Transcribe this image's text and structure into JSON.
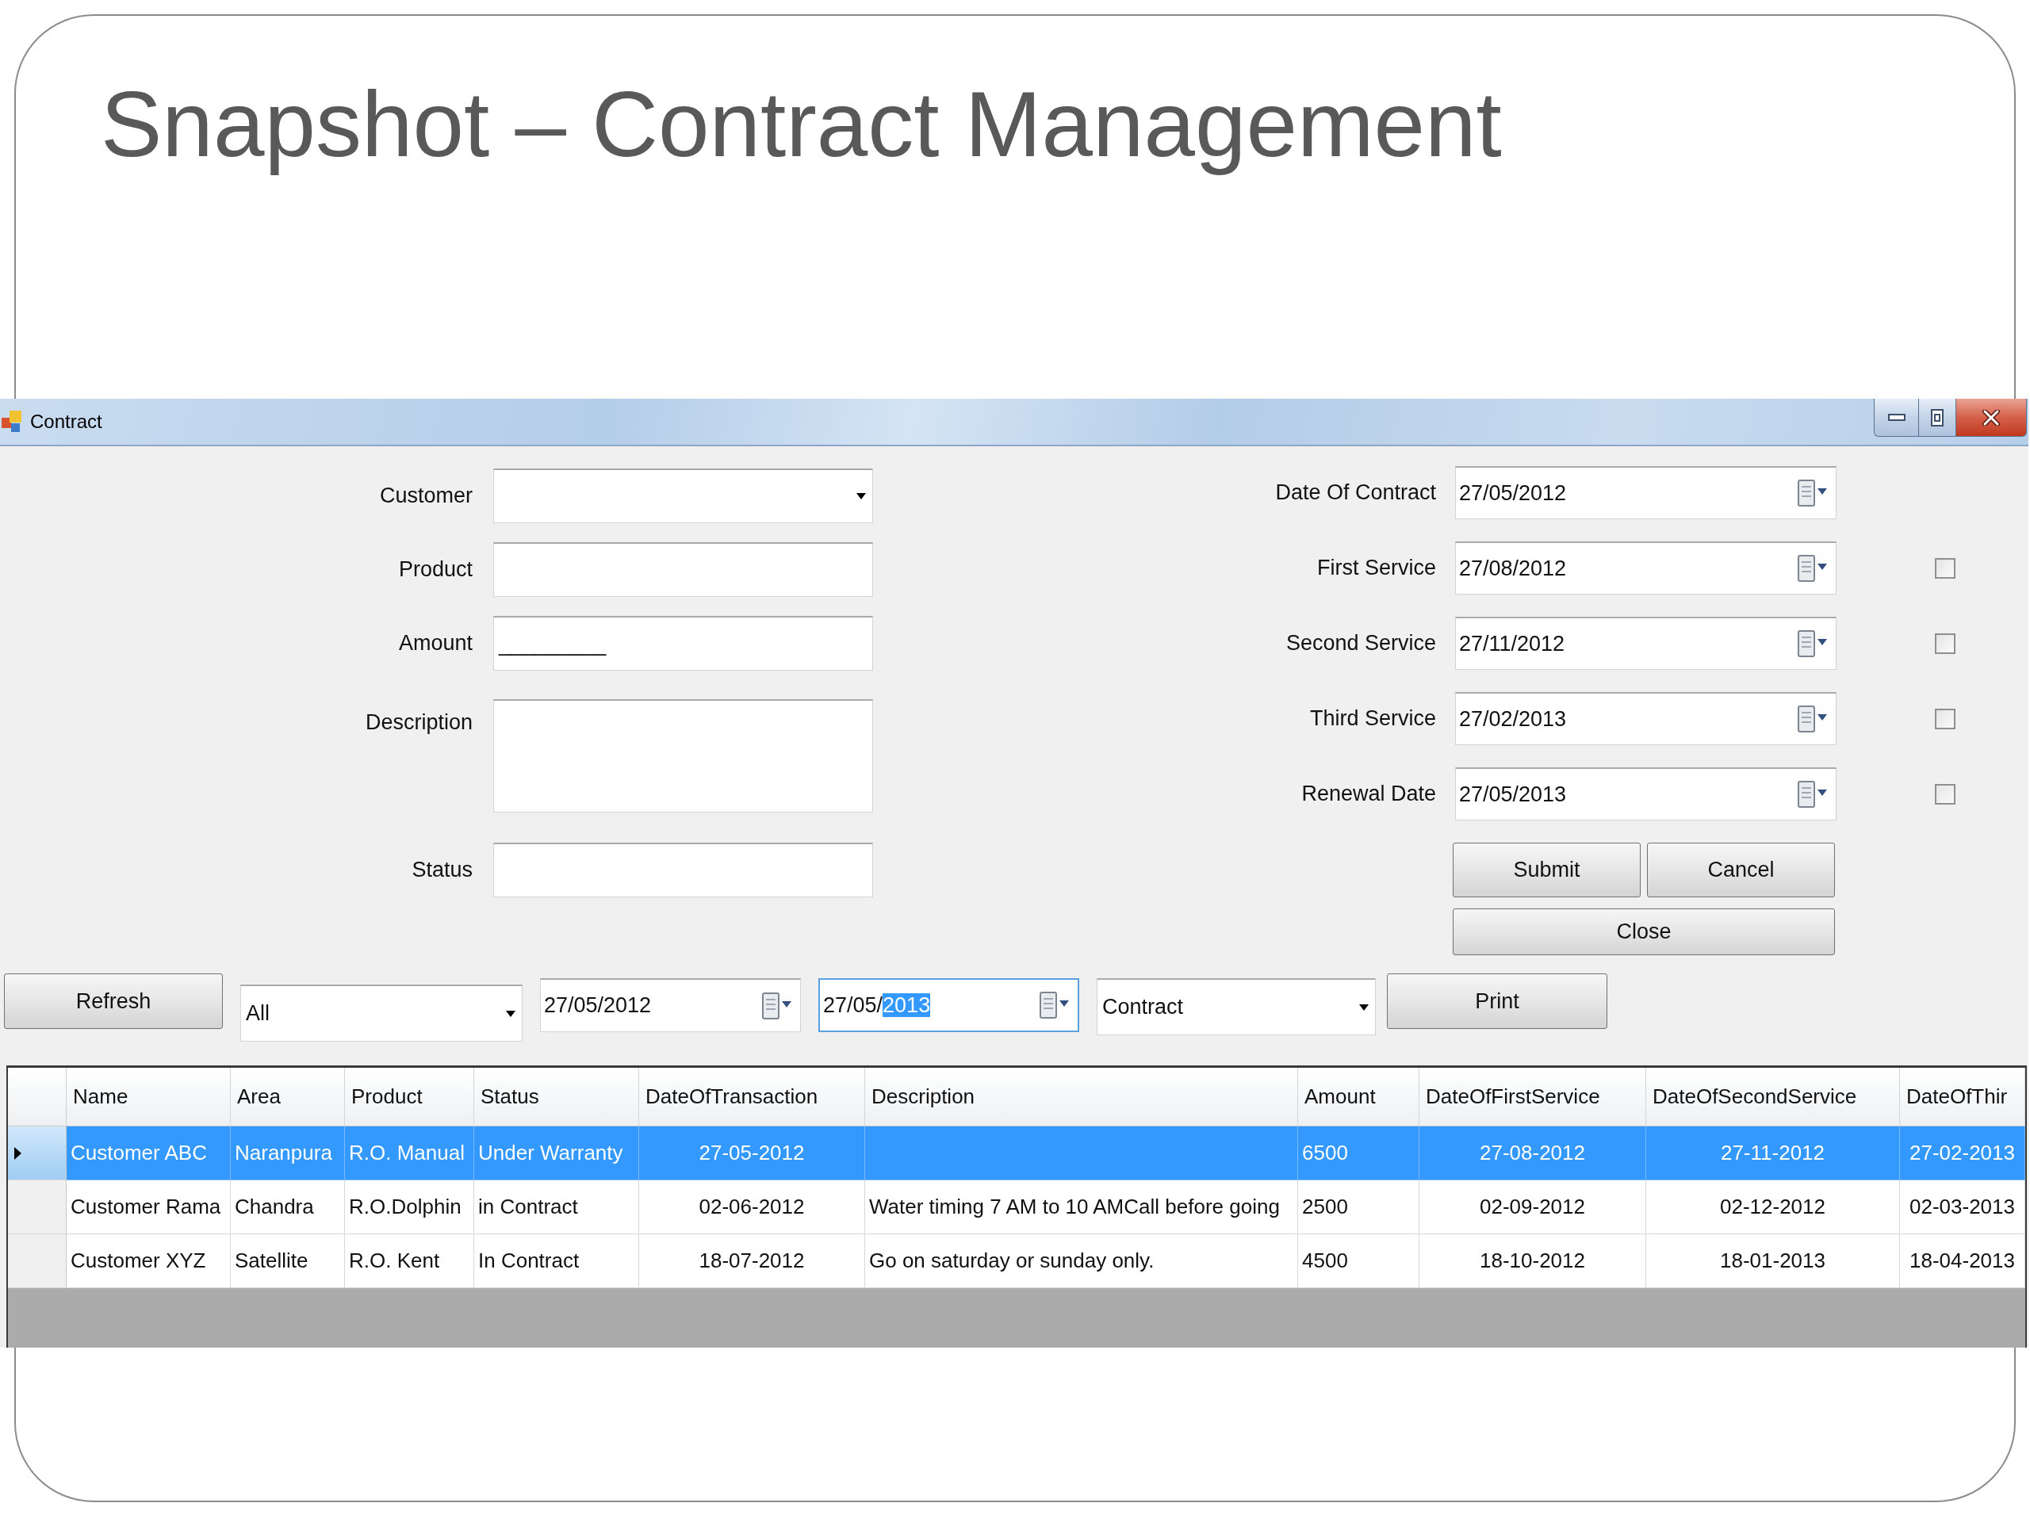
{
  "slide": {
    "title": "Snapshot – Contract Management"
  },
  "window": {
    "title": "Contract"
  },
  "form": {
    "fields": [
      {
        "label": "Customer",
        "kind": "combo"
      },
      {
        "label": "Product",
        "kind": "text"
      },
      {
        "label": "Amount",
        "kind": "masked",
        "value": "_________"
      },
      {
        "label": "Description",
        "kind": "multiline"
      },
      {
        "label": "Status",
        "kind": "text"
      }
    ],
    "date_fields": [
      {
        "label": "Date Of Contract",
        "value": "27/05/2012"
      },
      {
        "label": "First Service",
        "value": "27/08/2012",
        "checkbox": {
          "checked": false
        }
      },
      {
        "label": "Second Service",
        "value": "27/11/2012",
        "checkbox": {
          "checked": false
        }
      },
      {
        "label": "Third Service",
        "value": "27/02/2013",
        "checkbox": {
          "checked": false
        }
      },
      {
        "label": "Renewal Date",
        "value": "27/05/2013",
        "checkbox": {
          "checked": false
        }
      }
    ],
    "buttons": [
      "Submit",
      "Cancel",
      "Close"
    ]
  },
  "filter_bar": {
    "refresh_button": "Refresh",
    "scope_dropdown": "All",
    "from_date": {
      "value": "27/05/2012",
      "focused": false
    },
    "to_date": {
      "value": "27/05/",
      "selected_text": "2013",
      "focused": true
    },
    "type_dropdown": "Contract",
    "print_button": "Print"
  },
  "grid": {
    "columns": [
      {
        "label": "Name",
        "kind": "text"
      },
      {
        "label": "Area",
        "kind": "text"
      },
      {
        "label": "Product",
        "kind": "text"
      },
      {
        "label": "Status",
        "kind": "text"
      },
      {
        "label": "DateOfTransaction",
        "kind": "date"
      },
      {
        "label": "Description",
        "kind": "text"
      },
      {
        "label": "Amount",
        "kind": "text"
      },
      {
        "label": "DateOfFirstService",
        "kind": "date"
      },
      {
        "label": "DateOfSecondService",
        "kind": "date"
      },
      {
        "label": "DateOfThir",
        "kind": "date"
      }
    ],
    "rows": [
      {
        "selected": true,
        "cells": [
          "Customer ABC",
          "Naranpura",
          "R.O. Manual",
          "Under Warranty",
          "27-05-2012",
          null,
          "6500",
          "27-08-2012",
          "27-11-2012",
          "27-02-2013"
        ]
      },
      {
        "selected": false,
        "cells": [
          "Customer Rama",
          "Chandra",
          "R.O.Dolphin",
          "in Contract",
          "02-06-2012",
          "Water timing 7 AM to 10 AMCall before going",
          "2500",
          "02-09-2012",
          "02-12-2012",
          "02-03-2013"
        ]
      },
      {
        "selected": false,
        "cells": [
          "Customer XYZ",
          "Satellite",
          "R.O. Kent",
          "In Contract",
          "18-07-2012",
          "Go on saturday or sunday only.",
          "4500",
          "18-10-2012",
          "18-01-2013",
          "18-04-2013"
        ]
      }
    ]
  }
}
